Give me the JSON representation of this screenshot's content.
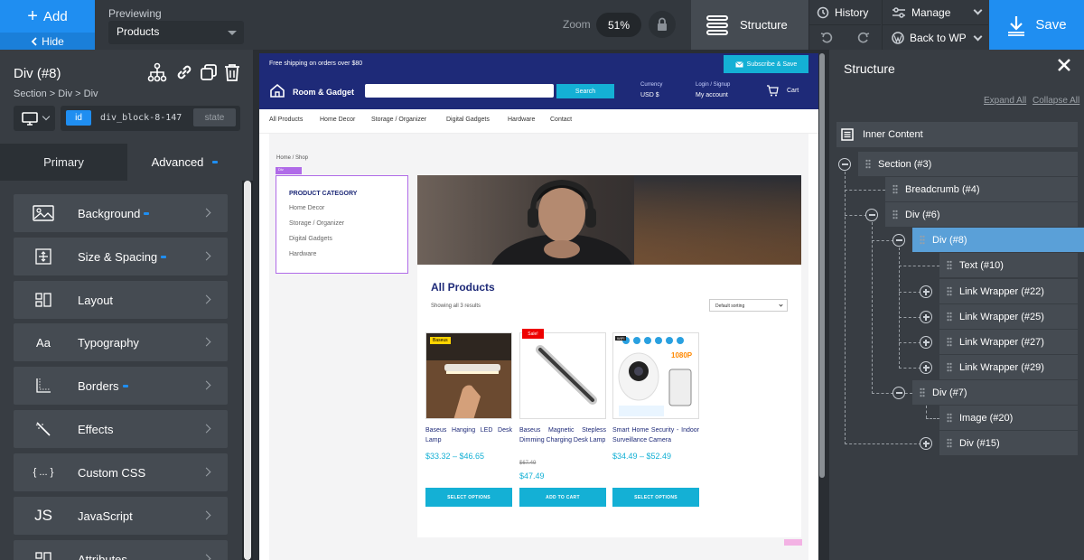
{
  "topbar": {
    "add_label": "Add",
    "hide_label": "Hide",
    "previewing_label": "Previewing",
    "previewing_value": "Products",
    "zoom_label": "Zoom",
    "zoom_value": "51%",
    "structure_label": "Structure",
    "history_label": "History",
    "manage_label": "Manage",
    "backwp_label": "Back to WP",
    "save_label": "Save"
  },
  "left": {
    "title": "Div (#8)",
    "breadcrumb": "Section > Div > Div",
    "id_badge": "id",
    "id_value": "div_block-8-147",
    "state_label": "state",
    "tab_primary": "Primary",
    "tab_advanced": "Advanced",
    "menu": [
      {
        "label": "Background",
        "icon": "image-icon",
        "modified": true
      },
      {
        "label": "Size & Spacing",
        "icon": "move-icon",
        "modified": true
      },
      {
        "label": "Layout",
        "icon": "layout-icon",
        "modified": false
      },
      {
        "label": "Typography",
        "icon": "typography-icon",
        "glyph": "Aa",
        "modified": false
      },
      {
        "label": "Borders",
        "icon": "borders-icon",
        "modified": true
      },
      {
        "label": "Effects",
        "icon": "wand-icon",
        "modified": false
      },
      {
        "label": "Custom CSS",
        "icon": "code-icon",
        "glyph": "{ ... }",
        "modified": false
      },
      {
        "label": "JavaScript",
        "icon": "js-icon",
        "glyph": "JS",
        "modified": false
      },
      {
        "label": "Attributes",
        "icon": "attributes-icon",
        "modified": false
      }
    ]
  },
  "site": {
    "ship_text": "Free shipping on orders over $80",
    "subscribe_label": "Subscribe & Save",
    "logo_text": "Room & Gadget",
    "search_btn": "Search",
    "currency_label": "Currency",
    "currency_value": "USD $",
    "login_label": "Login / Signup",
    "account_label": "My account",
    "cart_label": "Cart",
    "nav": [
      "All Products",
      "Home Decor",
      "Storage / Organizer",
      "Digital Gadgets",
      "Hardware",
      "Contact"
    ],
    "breadcrumb": "Home / Shop",
    "div_tag": "Div",
    "category_title": "PRODUCT CATEGORY",
    "categories": [
      "Home Decor",
      "Storage / Organizer",
      "Digital Gadgets",
      "Hardware"
    ],
    "heading": "All Products",
    "showing": "Showing all 3 results",
    "sort_value": "Default sorting",
    "sale_badge": "Sale!",
    "brand_tag": "Baseus",
    "res_tag": "1080P",
    "products": [
      {
        "name": "Baseus Hanging LED Desk Lamp",
        "price": "$33.32 – $46.65",
        "old_price": "",
        "button": "SELECT OPTIONS"
      },
      {
        "name": "Baseus Magnetic Stepless Dimming Charging Desk Lamp",
        "price": "$47.49",
        "old_price": "$67.49",
        "button": "ADD TO CART"
      },
      {
        "name": "Smart Home Security - Indoor Surveillance Camera",
        "price": "$34.49 – $52.49",
        "old_price": "",
        "button": "SELECT OPTIONS"
      }
    ]
  },
  "structure": {
    "title": "Structure",
    "expand_all": "Expand All",
    "collapse_all": "Collapse All",
    "root": "Inner Content",
    "nodes": [
      {
        "label": "Section (#3)",
        "toggle": "minus"
      },
      {
        "label": "Breadcrumb (#4)",
        "toggle": ""
      },
      {
        "label": "Div (#6)",
        "toggle": "minus"
      },
      {
        "label": "Div (#8)",
        "toggle": "minus",
        "selected": true
      },
      {
        "label": "Text (#10)",
        "toggle": ""
      },
      {
        "label": "Link Wrapper (#22)",
        "toggle": "plus"
      },
      {
        "label": "Link Wrapper (#25)",
        "toggle": "plus"
      },
      {
        "label": "Link Wrapper (#27)",
        "toggle": "plus"
      },
      {
        "label": "Link Wrapper (#29)",
        "toggle": "plus"
      },
      {
        "label": "Div (#7)",
        "toggle": "minus"
      },
      {
        "label": "Image (#20)",
        "toggle": ""
      },
      {
        "label": "Div (#15)",
        "toggle": "plus"
      }
    ]
  },
  "colors": {
    "accent": "#1f8ef1",
    "site_navy": "#1e2a78",
    "site_cyan": "#14b0d5",
    "selected_node": "#5aa0d8"
  }
}
